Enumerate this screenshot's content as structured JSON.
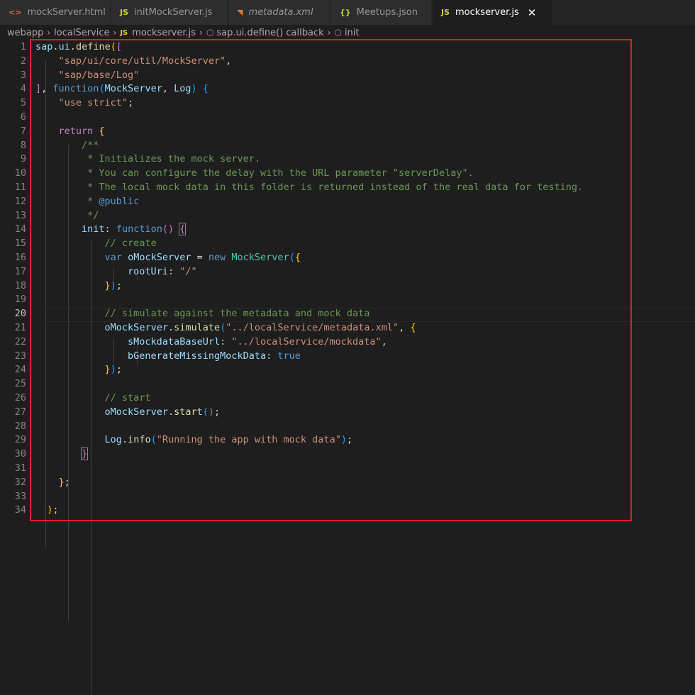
{
  "tabs": [
    {
      "label": "mockServer.html",
      "icon": "<>",
      "iconName": "html-file-icon",
      "iconColor": "#e37933"
    },
    {
      "label": "initMockServer.js",
      "icon": "JS",
      "iconName": "js-file-icon",
      "iconColor": "#cbcb41"
    },
    {
      "label": "metadata.xml",
      "icon": "◥",
      "iconName": "rss-xml-file-icon",
      "iconColor": "#e37933",
      "italic": true
    },
    {
      "label": "Meetups.json",
      "icon": "{}",
      "iconName": "json-file-icon",
      "iconColor": "#cbcb41"
    },
    {
      "label": "mockserver.js",
      "icon": "JS",
      "iconName": "js-file-icon",
      "iconColor": "#cbcb41",
      "active": true
    }
  ],
  "breadcrumb": [
    "webapp",
    "localService",
    "mockserver.js",
    "sap.ui.define() callback",
    "init"
  ],
  "breadcrumb_separator": "›",
  "close_glyph": "✕",
  "cube_glyph": "⬡",
  "js_badge": "JS",
  "current_line": 20,
  "colors": {
    "keyword": "#569cd6",
    "control": "#c586c0",
    "string": "#ce9178",
    "variable": "#9cdcfe",
    "function": "#dcdcaa",
    "class": "#4ec9b0",
    "comment": "#6a9955",
    "punctuation": "#d4d4d4",
    "highlight_box": "#e01e26"
  },
  "code": [
    [
      [
        "v",
        "sap"
      ],
      [
        "p",
        "."
      ],
      [
        "v",
        "ui"
      ],
      [
        "p",
        "."
      ],
      [
        "f",
        "define"
      ],
      [
        "b1",
        "("
      ],
      [
        "b2",
        "["
      ]
    ],
    [
      [
        "p",
        "    "
      ],
      [
        "s",
        "\"sap/ui/core/util/MockServer\""
      ],
      [
        "p",
        ","
      ]
    ],
    [
      [
        "p",
        "    "
      ],
      [
        "s",
        "\"sap/base/Log\""
      ]
    ],
    [
      [
        "b2",
        "]"
      ],
      [
        "p",
        ", "
      ],
      [
        "k",
        "function"
      ],
      [
        "b3",
        "("
      ],
      [
        "v",
        "MockServer"
      ],
      [
        "p",
        ", "
      ],
      [
        "v",
        "Log"
      ],
      [
        "b3",
        ")"
      ],
      [
        "p",
        " "
      ],
      [
        "b3",
        "{"
      ]
    ],
    [
      [
        "p",
        "    "
      ],
      [
        "s",
        "\"use strict\""
      ],
      [
        "p",
        ";"
      ]
    ],
    [],
    [
      [
        "p",
        "    "
      ],
      [
        "c",
        "return"
      ],
      [
        "p",
        " "
      ],
      [
        "b1",
        "{"
      ]
    ],
    [
      [
        "p",
        "        "
      ],
      [
        "cm",
        "/**"
      ]
    ],
    [
      [
        "cm",
        "         * Initializes the mock server."
      ]
    ],
    [
      [
        "cm",
        "         * You can configure the delay with the URL parameter \"serverDelay\"."
      ]
    ],
    [
      [
        "cm",
        "         * The local mock data in this folder is returned instead of the real data for testing."
      ]
    ],
    [
      [
        "cm",
        "         * "
      ],
      [
        "k",
        "@public"
      ]
    ],
    [
      [
        "cm",
        "         */"
      ]
    ],
    [
      [
        "p",
        "        "
      ],
      [
        "v",
        "init"
      ],
      [
        "p",
        ": "
      ],
      [
        "k",
        "function"
      ],
      [
        "b2",
        "()"
      ],
      [
        "p",
        " "
      ],
      [
        "b2bm",
        "{"
      ]
    ],
    [
      [
        "p",
        "            "
      ],
      [
        "cm",
        "// create"
      ]
    ],
    [
      [
        "p",
        "            "
      ],
      [
        "k",
        "var"
      ],
      [
        "p",
        " "
      ],
      [
        "v",
        "oMockServer"
      ],
      [
        "p",
        " = "
      ],
      [
        "k",
        "new"
      ],
      [
        "p",
        " "
      ],
      [
        "t",
        "MockServer"
      ],
      [
        "b3",
        "("
      ],
      [
        "b1",
        "{"
      ]
    ],
    [
      [
        "p",
        "                "
      ],
      [
        "v",
        "rootUri"
      ],
      [
        "p",
        ": "
      ],
      [
        "s",
        "\"/\""
      ]
    ],
    [
      [
        "p",
        "            "
      ],
      [
        "b1",
        "}"
      ],
      [
        "b3",
        ")"
      ],
      [
        "p",
        ";"
      ]
    ],
    [],
    [
      [
        "p",
        "            "
      ],
      [
        "cm",
        "// simulate against the metadata and mock data"
      ]
    ],
    [
      [
        "p",
        "            "
      ],
      [
        "v",
        "oMockServer"
      ],
      [
        "p",
        "."
      ],
      [
        "f",
        "simulate"
      ],
      [
        "b3",
        "("
      ],
      [
        "s",
        "\"../localService/metadata.xml\""
      ],
      [
        "p",
        ", "
      ],
      [
        "b1",
        "{"
      ]
    ],
    [
      [
        "p",
        "                "
      ],
      [
        "v",
        "sMockdataBaseUrl"
      ],
      [
        "p",
        ": "
      ],
      [
        "s",
        "\"../localService/mockdata\""
      ],
      [
        "p",
        ","
      ]
    ],
    [
      [
        "p",
        "                "
      ],
      [
        "v",
        "bGenerateMissingMockData"
      ],
      [
        "p",
        ": "
      ],
      [
        "k",
        "true"
      ]
    ],
    [
      [
        "p",
        "            "
      ],
      [
        "b1",
        "}"
      ],
      [
        "b3",
        ")"
      ],
      [
        "p",
        ";"
      ]
    ],
    [],
    [
      [
        "p",
        "            "
      ],
      [
        "cm",
        "// start"
      ]
    ],
    [
      [
        "p",
        "            "
      ],
      [
        "v",
        "oMockServer"
      ],
      [
        "p",
        "."
      ],
      [
        "f",
        "start"
      ],
      [
        "b3",
        "()"
      ],
      [
        "p",
        ";"
      ]
    ],
    [],
    [
      [
        "p",
        "            "
      ],
      [
        "v",
        "Log"
      ],
      [
        "p",
        "."
      ],
      [
        "f",
        "info"
      ],
      [
        "b3",
        "("
      ],
      [
        "s",
        "\"Running the app with mock data\""
      ],
      [
        "b3",
        ")"
      ],
      [
        "p",
        ";"
      ]
    ],
    [
      [
        "p",
        "        "
      ],
      [
        "b2bm",
        "}"
      ]
    ],
    [],
    [
      [
        "p",
        "    "
      ],
      [
        "b1",
        "}"
      ],
      [
        "p",
        ";"
      ]
    ],
    [],
    [
      [
        "p",
        "  "
      ],
      [
        "b1",
        ")"
      ],
      [
        "p",
        ";"
      ]
    ]
  ]
}
